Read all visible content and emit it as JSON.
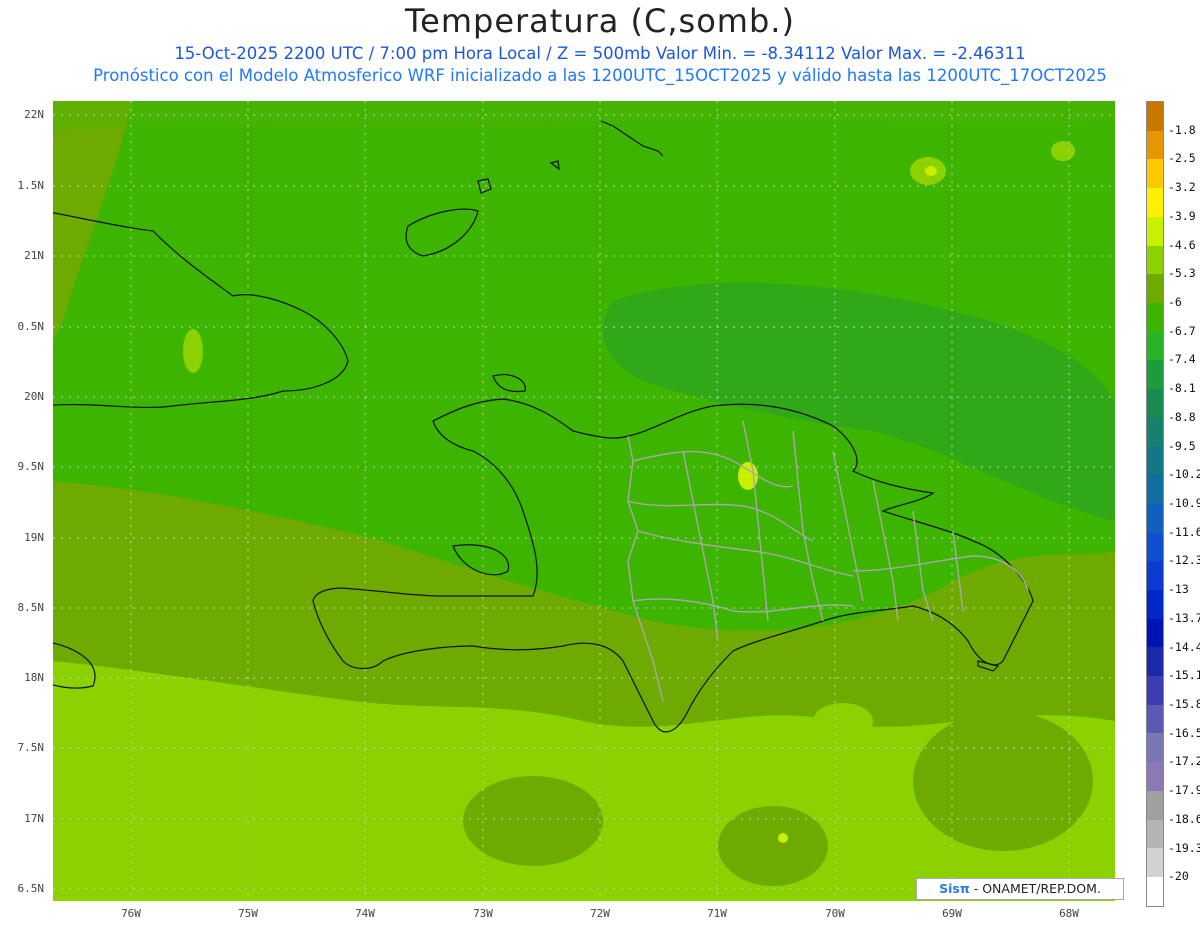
{
  "title": "Temperatura (C,somb.)",
  "subtitle_line1": "15-Oct-2025  2200 UTC / 7:00 pm Hora Local / Z = 500mb  Valor Min. = -8.34112  Valor Max. = -2.46311",
  "subtitle_line2": "Pronóstico con el Modelo Atmosferico WRF inicializado a las 1200UTC_15OCT2025 y válido hasta las  1200UTC_17OCT2025",
  "credit": {
    "sis": "Sis",
    "pi": "π",
    "rest": " - ONAMET/REP.DOM."
  },
  "lat_labels": [
    "22N",
    "1.5N",
    "21N",
    "0.5N",
    "20N",
    "9.5N",
    "19N",
    "8.5N",
    "18N",
    "7.5N",
    "17N",
    "6.5N"
  ],
  "lon_labels": [
    "76W",
    "75W",
    "74W",
    "73W",
    "72W",
    "71W",
    "70W",
    "69W",
    "68W"
  ],
  "colorbar": {
    "labels": [
      "-1.8",
      "-2.5",
      "-3.2",
      "-3.9",
      "-4.6",
      "-5.3",
      "-6",
      "-6.7",
      "-7.4",
      "-8.1",
      "-8.8",
      "-9.5",
      "-10.2",
      "-10.9",
      "-11.6",
      "-12.3",
      "-13",
      "-13.7",
      "-14.4",
      "-15.1",
      "-15.8",
      "-16.5",
      "-17.2",
      "-17.9",
      "-18.6",
      "-19.3",
      "-20"
    ],
    "colors": [
      "#c87800",
      "#e69600",
      "#ffc800",
      "#fff000",
      "#c8f000",
      "#8cd200",
      "#6eaa00",
      "#3cb400",
      "#28b428",
      "#1e9c3c",
      "#188c50",
      "#14826e",
      "#127888",
      "#106ea0",
      "#1060c0",
      "#1050d0",
      "#0a3cd2",
      "#0028c8",
      "#0014b4",
      "#1e28aa",
      "#3c3cb4",
      "#5a5ab4",
      "#7878b4",
      "#8c78b4",
      "#a0a0a0",
      "#b4b4b4",
      "#d2d2d2",
      "#ffffff"
    ]
  },
  "field_colors": {
    "minus_4_6": "#8cd200",
    "minus_5_3": "#6eaa00",
    "minus_6": "#3cb400",
    "minus_6_7": "#28a028",
    "minus_3_9": "#c8f000"
  }
}
